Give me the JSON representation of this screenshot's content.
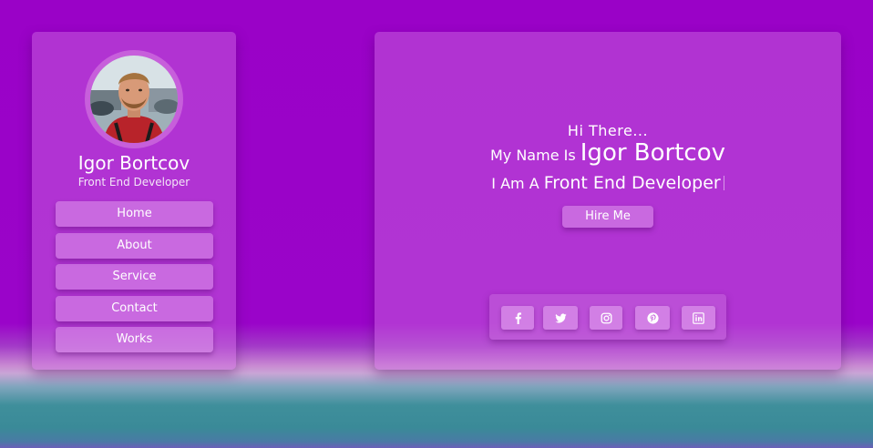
{
  "sidebar": {
    "name": "Igor Bortcov",
    "role": "Front End Developer",
    "nav": [
      {
        "label": "Home"
      },
      {
        "label": "About"
      },
      {
        "label": "Service"
      },
      {
        "label": "Contact"
      },
      {
        "label": "Works"
      }
    ]
  },
  "hero": {
    "greeting": "Hi There...",
    "name_prefix": "My Name Is",
    "name": "Igor Bortcov",
    "role_prefix": "I Am A",
    "role": "Front End Developer",
    "hire_label": "Hire Me"
  },
  "social": {
    "icons": [
      "facebook-icon",
      "twitter-icon",
      "instagram-icon",
      "pinterest-icon",
      "linkedin-icon"
    ]
  },
  "colors": {
    "background": "#9a02c7",
    "panel": "#b43bd2",
    "button": "#c867dc",
    "text": "#ffffff"
  }
}
